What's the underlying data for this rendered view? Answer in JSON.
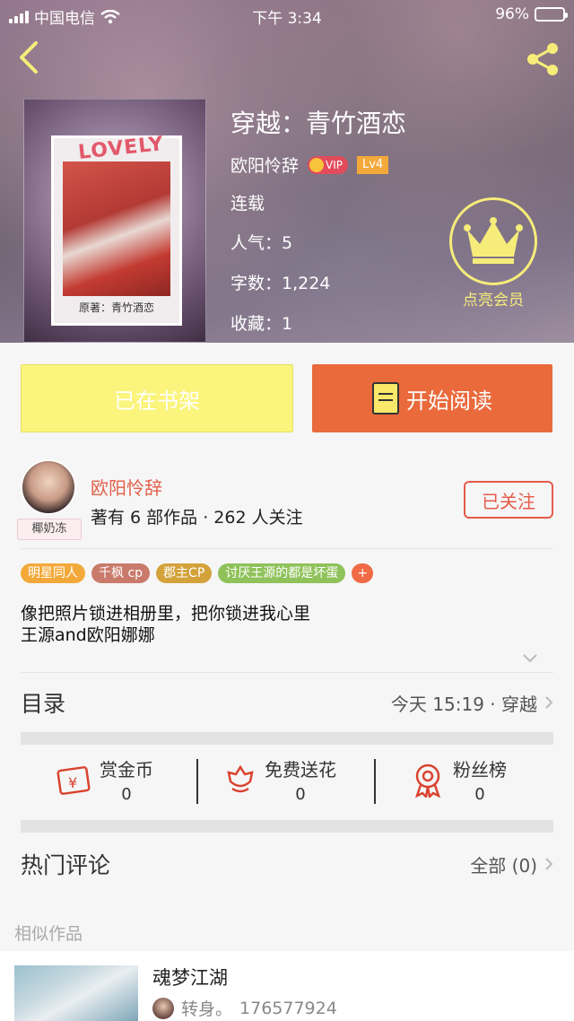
{
  "status_bar": {
    "carrier": "中国电信",
    "time": "下午 3:34",
    "battery": "96%"
  },
  "book": {
    "title": "穿越：青竹酒恋",
    "author": "欧阳怜辞",
    "vip_label": "VIP",
    "level": "Lv4",
    "status": "连载",
    "popularity": "人气：5",
    "word_count": "字数：1,224",
    "favorites": "收藏：1",
    "cover_text": "LOVELY",
    "cover_caption": "原著：青竹酒恋"
  },
  "member": {
    "label": "点亮会员"
  },
  "buttons": {
    "shelf": "已在书架",
    "read": "开始阅读"
  },
  "author_info": {
    "avatar_tag": "椰奶冻",
    "name": "欧阳怜辞",
    "summary": "著有 6 部作品 · 262 人关注",
    "follow_label": "已关注"
  },
  "tags": [
    {
      "label": "明星同人",
      "color": "#f3a93a"
    },
    {
      "label": "千枫 cp",
      "color": "#c97a6a"
    },
    {
      "label": "郡主CP",
      "color": "#d4a23a"
    },
    {
      "label": "讨厌王源的都是坏蛋",
      "color": "#8fc25a"
    }
  ],
  "tag_add": "+",
  "description": {
    "line1": "像把照片锁进相册里，把你锁进我心里",
    "line2": "王源and欧阳娜娜"
  },
  "toc": {
    "title": "目录",
    "latest": "今天 15:19 · 穿越"
  },
  "stats": [
    {
      "label": "赏金币",
      "value": "0",
      "icon": "red-envelope-icon"
    },
    {
      "label": "免费送花",
      "value": "0",
      "icon": "flower-icon"
    },
    {
      "label": "粉丝榜",
      "value": "0",
      "icon": "medal-icon"
    }
  ],
  "comments": {
    "title": "热门评论",
    "all": "全部 (0)"
  },
  "similar": {
    "heading": "相似作品",
    "item": {
      "title": "魂梦江湖",
      "author": "转身。",
      "id_text": "176577924"
    }
  },
  "colors": {
    "accent": "#ea6a3c",
    "shelf": "#fbf47d",
    "member": "#f6ec7a",
    "follow": "#e55b4a"
  }
}
